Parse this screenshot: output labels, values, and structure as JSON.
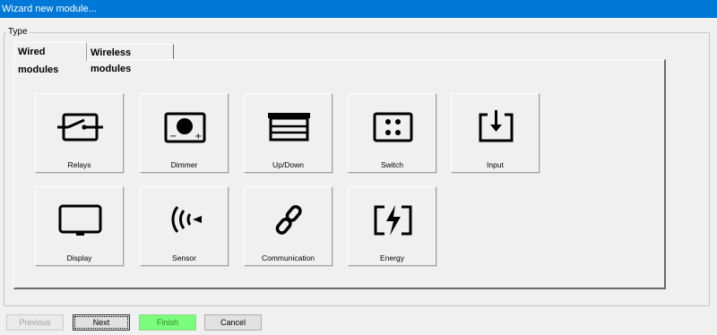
{
  "window": {
    "title": "Wizard new module..."
  },
  "group": {
    "legend": "Type"
  },
  "tabs": [
    {
      "label": "Wired modules",
      "active": true
    },
    {
      "label": "Wireless modules",
      "active": false
    }
  ],
  "modules": [
    {
      "label": "Relays",
      "icon": "relay-icon"
    },
    {
      "label": "Dimmer",
      "icon": "dimmer-icon"
    },
    {
      "label": "Up/Down",
      "icon": "up-down-icon"
    },
    {
      "label": "Switch",
      "icon": "switch-icon"
    },
    {
      "label": "Input",
      "icon": "input-icon"
    },
    {
      "label": "Display",
      "icon": "display-icon"
    },
    {
      "label": "Sensor",
      "icon": "sensor-icon"
    },
    {
      "label": "Communication",
      "icon": "link-icon"
    },
    {
      "label": "Energy",
      "icon": "energy-icon"
    }
  ],
  "dimmer_icon_text": {
    "minus": "−",
    "plus": "+"
  },
  "buttons": {
    "previous": "Previous",
    "next": "Next",
    "finish": "Finish",
    "cancel": "Cancel"
  },
  "colors": {
    "titlebar": "#0078d7",
    "finish_button": "#7cfc7c"
  }
}
